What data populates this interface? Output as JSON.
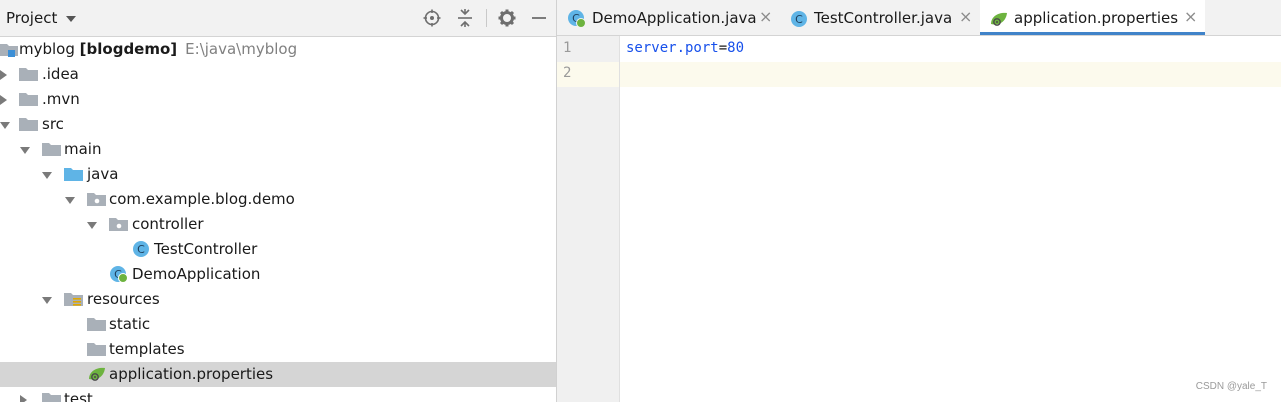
{
  "project_panel": {
    "title": "Project",
    "toolbar_icons": [
      "locate-icon",
      "collapse-all-icon",
      "gear-icon",
      "hide-icon"
    ]
  },
  "tree": {
    "root": {
      "name": "myblog",
      "module": "[blogdemo]",
      "path": "E:\\java\\myblog"
    },
    "items": [
      {
        "label": ".idea",
        "icon": "folder-icon",
        "expanded": false
      },
      {
        "label": ".mvn",
        "icon": "folder-icon",
        "expanded": false
      },
      {
        "label": "src",
        "icon": "folder-icon",
        "expanded": true
      },
      {
        "label": "main",
        "icon": "folder-icon",
        "expanded": true
      },
      {
        "label": "java",
        "icon": "source-folder-icon",
        "expanded": true
      },
      {
        "label": "com.example.blog.demo",
        "icon": "package-icon",
        "expanded": true
      },
      {
        "label": "controller",
        "icon": "package-icon",
        "expanded": true
      },
      {
        "label": "TestController",
        "icon": "java-class-icon"
      },
      {
        "label": "DemoApplication",
        "icon": "spring-boot-class-icon"
      },
      {
        "label": "resources",
        "icon": "resources-folder-icon",
        "expanded": true
      },
      {
        "label": "static",
        "icon": "folder-icon"
      },
      {
        "label": "templates",
        "icon": "folder-icon"
      },
      {
        "label": "application.properties",
        "icon": "spring-properties-icon",
        "selected": true
      },
      {
        "label": "test",
        "icon": "folder-icon",
        "expanded": false
      }
    ]
  },
  "editor": {
    "tabs": [
      {
        "label": "DemoApplication.java",
        "icon": "spring-boot-class-icon",
        "active": false
      },
      {
        "label": "TestController.java",
        "icon": "java-class-icon",
        "active": false
      },
      {
        "label": "application.properties",
        "icon": "spring-properties-icon",
        "active": true
      }
    ],
    "close_glyph": "×",
    "line_numbers": [
      "1",
      "2"
    ],
    "code": {
      "key": "server.port",
      "sep": "=",
      "value": "80"
    }
  },
  "watermark": "CSDN @yale_T",
  "colors": {
    "accent": "#4083c9",
    "selection": "#d5d5d5",
    "current_line": "#fcfaed",
    "folder": "#a9b0b8",
    "java_folder": "#5fb4e6",
    "class_circle": "#5fb4e6",
    "spring_green": "#6db33f",
    "code_blue": "#1750eb"
  }
}
